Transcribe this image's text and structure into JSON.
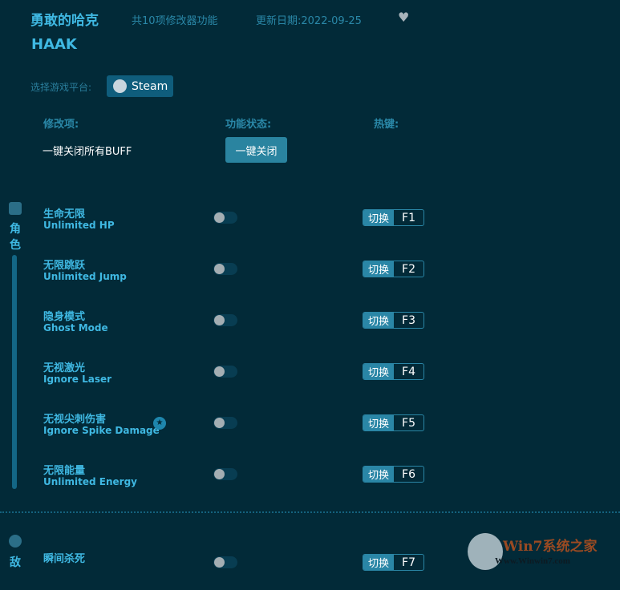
{
  "header": {
    "title": "勇敢的哈克",
    "feature_count": "共10项修改器功能",
    "update_date": "更新日期:2022-09-25",
    "title_en": "HAAK"
  },
  "platform": {
    "label": "选择游戏平台:",
    "selected": "Steam"
  },
  "columns": {
    "item": "修改项:",
    "status": "功能状态:",
    "hotkey": "热键:"
  },
  "all_buff": {
    "label": "一键关闭所有BUFF",
    "button": "一键关闭"
  },
  "sections": [
    {
      "label_chars": [
        "角",
        "色"
      ]
    },
    {
      "label_chars": [
        "敌"
      ]
    }
  ],
  "switch_label": "切换",
  "items": [
    {
      "cn": "生命无限",
      "en": "Unlimited HP",
      "key": "F1",
      "on": false
    },
    {
      "cn": "无限跳跃",
      "en": "Unlimited Jump",
      "key": "F2",
      "on": false
    },
    {
      "cn": "隐身模式",
      "en": "Ghost Mode",
      "key": "F3",
      "on": false
    },
    {
      "cn": "无视激光",
      "en": "Ignore Laser",
      "key": "F4",
      "on": false
    },
    {
      "cn": "无视尖刺伤害",
      "en": "Ignore Spike Damage",
      "key": "F5",
      "on": false,
      "starred": true
    },
    {
      "cn": "无限能量",
      "en": "Unlimited Energy",
      "key": "F6",
      "on": false
    },
    {
      "cn": "瞬间杀死",
      "en": "",
      "key": "F7",
      "on": false
    }
  ],
  "watermark": {
    "brand": "Win7系统之家",
    "url": "Www.Winwin7.com"
  }
}
